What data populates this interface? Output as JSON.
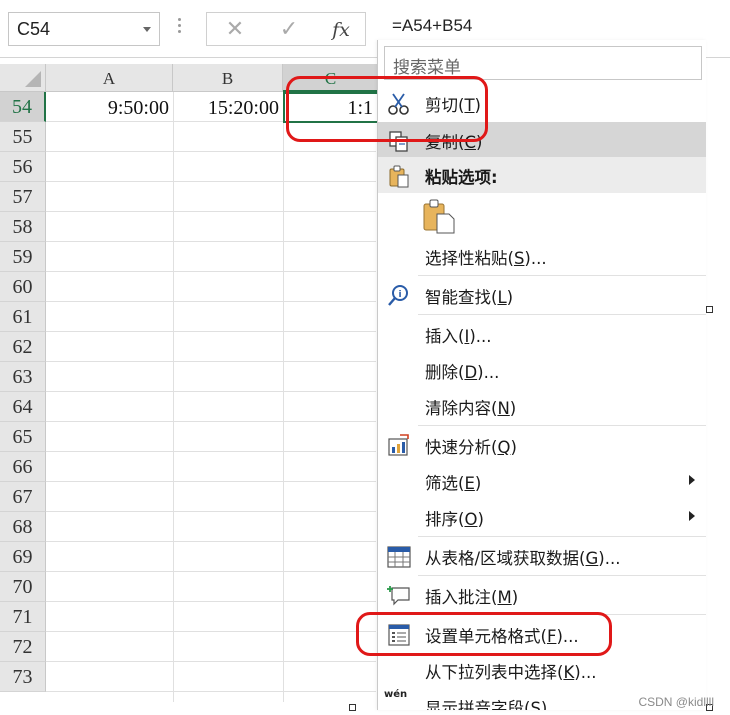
{
  "formula_bar": {
    "name_box": "C54",
    "cancel_icon": "✕",
    "enter_icon": "✓",
    "fx_label": "fx",
    "formula": "=A54+B54"
  },
  "columns": [
    "A",
    "B",
    "C"
  ],
  "rows": [
    "54",
    "55",
    "56",
    "57",
    "58",
    "59",
    "60",
    "61",
    "62",
    "63",
    "64",
    "65",
    "66",
    "67",
    "68",
    "69",
    "70",
    "71",
    "72",
    "73"
  ],
  "cells": {
    "A54": "9:50:00",
    "B54": "15:20:00",
    "C54": "1:1"
  },
  "context_menu": {
    "search_placeholder": "搜索菜单",
    "cut": {
      "label": "剪切(",
      "key": "T",
      "tail": ")",
      "icon": "scissors-icon"
    },
    "copy": {
      "label": "复制(",
      "key": "C",
      "tail": ")",
      "icon": "copy-icon"
    },
    "paste_header": "粘贴选项:",
    "paste_selective": {
      "label": "选择性粘贴(",
      "key": "S",
      "tail": ")..."
    },
    "smart_lookup": {
      "label": "智能查找(",
      "key": "L",
      "tail": ")"
    },
    "insert": {
      "label": "插入(",
      "key": "I",
      "tail": ")..."
    },
    "delete": {
      "label": "删除(",
      "key": "D",
      "tail": ")..."
    },
    "clear": {
      "label": "清除内容(",
      "key": "N",
      "tail": ")"
    },
    "quick_analysis": {
      "label": "快速分析(",
      "key": "Q",
      "tail": ")"
    },
    "filter": {
      "label": "筛选(",
      "key": "E",
      "tail": ")"
    },
    "sort": {
      "label": "排序(",
      "key": "O",
      "tail": ")"
    },
    "get_data": {
      "label": "从表格/区域获取数据(",
      "key": "G",
      "tail": ")..."
    },
    "comment": {
      "label": "插入批注(",
      "key": "M",
      "tail": ")"
    },
    "format_cells": {
      "label": "设置单元格格式(",
      "key": "F",
      "tail": ")..."
    },
    "pick_list": {
      "label": "从下拉列表中选择(",
      "key": "K",
      "tail": ")..."
    },
    "phonetic": {
      "label": "显示拼音字段(",
      "key": "S",
      "tail": ")"
    },
    "phonetic_icon_text": "wén"
  },
  "colors": {
    "accent": "#217346",
    "highlight_red": "#e01818"
  },
  "watermark": "CSDN @kidllll"
}
